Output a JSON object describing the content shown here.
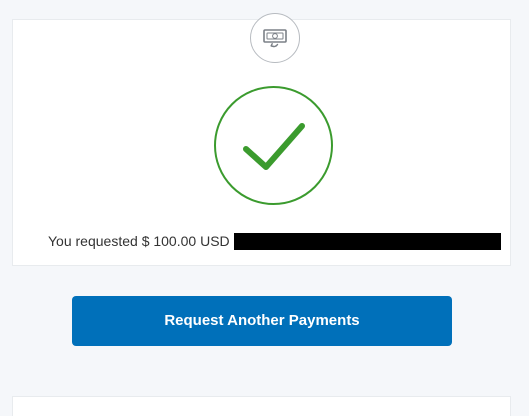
{
  "confirmation": {
    "header_icon": "money-return-icon",
    "status_icon": "checkmark-icon",
    "message_prefix": "You requested",
    "amount": "$ 100.00",
    "currency": "USD",
    "recipient_redacted": true
  },
  "actions": {
    "request_another_label": "Request Another Payments"
  },
  "colors": {
    "page_background": "#f5f7fa",
    "card_background": "#ffffff",
    "success_green": "#3b9b2e",
    "primary_button": "#0070ba",
    "text": "#333333",
    "redaction": "#000000"
  }
}
